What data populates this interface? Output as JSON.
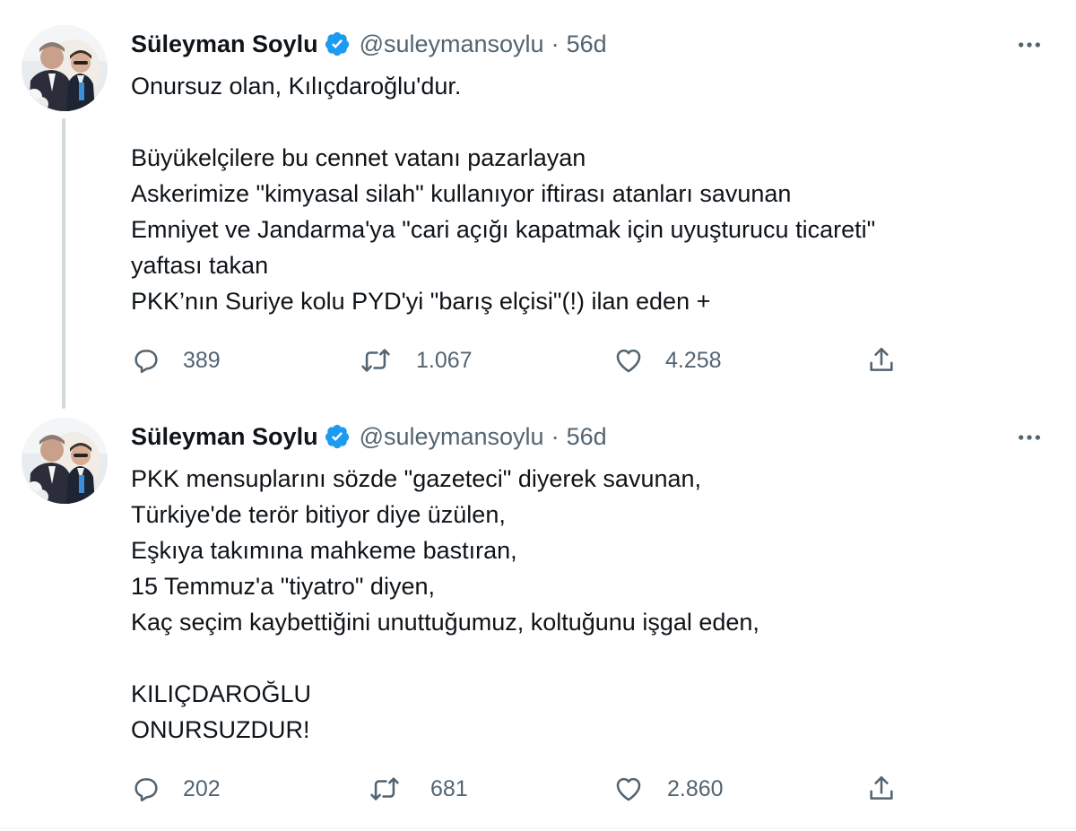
{
  "colors": {
    "text_primary": "#0f1419",
    "text_secondary": "#536471",
    "verified_blue": "#1d9bf0",
    "thread_line": "#cfd9de",
    "background": "#ffffff"
  },
  "tweets": [
    {
      "author": {
        "display_name": "Süleyman Soylu",
        "handle": "@suleymansoylu",
        "verified": true,
        "avatar": "profile-photo"
      },
      "separator": "·",
      "time": "56d",
      "text_lines": [
        "Onursuz olan, Kılıçdaroğlu'dur.",
        "",
        "Büyükelçilere bu cennet vatanı pazarlayan",
        "Askerimize \"kimyasal silah\" kullanıyor iftirası atanları savunan",
        "Emniyet ve Jandarma'ya \"cari açığı kapatmak için uyuşturucu ticareti\"",
        "yaftası takan",
        "PKK’nın Suriye kolu PYD'yi \"barış elçisi\"(!) ilan eden +"
      ],
      "stats": {
        "replies": "389",
        "retweets": "1.067",
        "likes": "4.258"
      },
      "icons": [
        "reply-icon",
        "retweet-icon",
        "like-icon",
        "share-icon",
        "more-icon",
        "verified-badge-icon"
      ]
    },
    {
      "author": {
        "display_name": "Süleyman Soylu",
        "handle": "@suleymansoylu",
        "verified": true,
        "avatar": "profile-photo"
      },
      "separator": "·",
      "time": "56d",
      "text_lines": [
        "PKK mensuplarını sözde \"gazeteci\" diyerek savunan,",
        "Türkiye'de terör bitiyor diye üzülen,",
        "Eşkıya takımına mahkeme bastıran,",
        "15 Temmuz'a \"tiyatro\" diyen,",
        "Kaç seçim kaybettiğini unuttuğumuz, koltuğunu işgal eden,",
        "",
        "KILIÇDAROĞLU",
        "ONURSUZDUR!"
      ],
      "stats": {
        "replies": "202",
        "retweets": "681",
        "likes": "2.860"
      },
      "icons": [
        "reply-icon",
        "retweet-icon",
        "like-icon",
        "share-icon",
        "more-icon",
        "verified-badge-icon"
      ]
    }
  ]
}
